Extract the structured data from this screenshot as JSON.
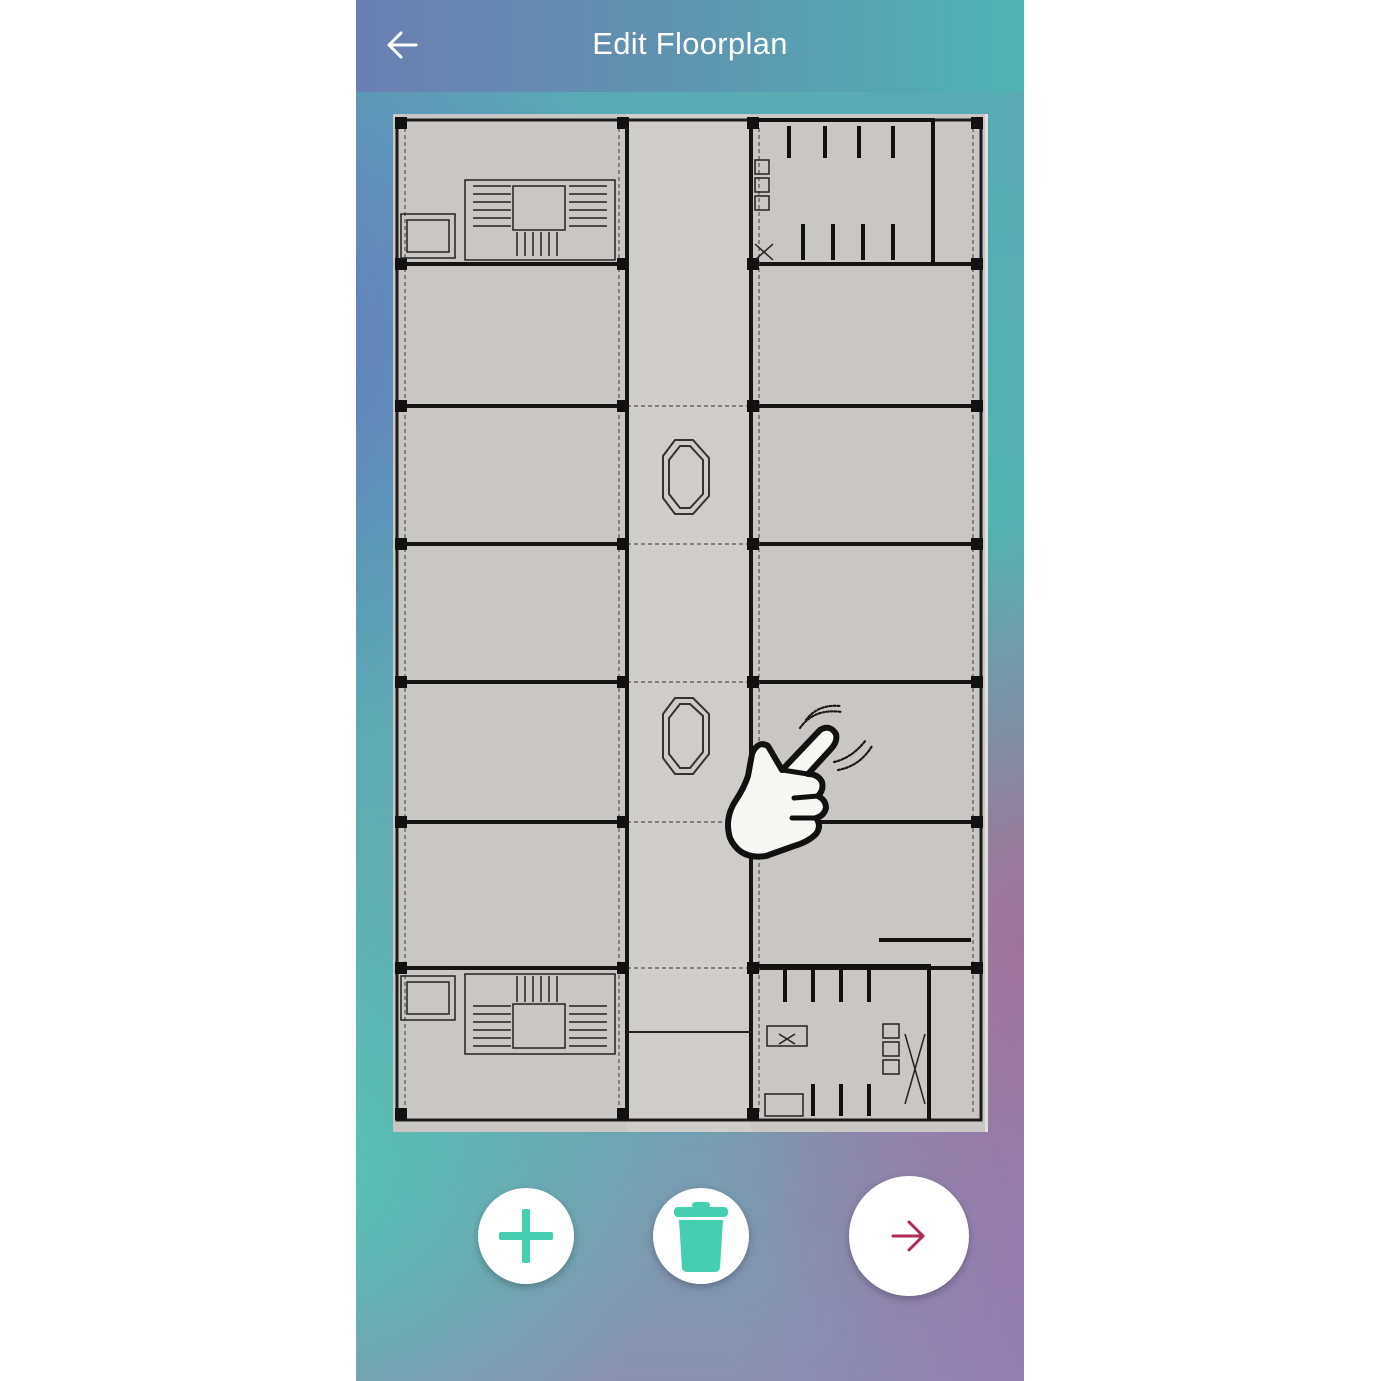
{
  "app": {
    "title": "Edit Floorplan"
  },
  "icons": {
    "back": "arrow-left-icon",
    "add": "plus-icon",
    "delete": "trash-icon",
    "next": "arrow-right-icon",
    "gesture": "tap-hand-icon"
  },
  "colors": {
    "accent": "#45cfb0",
    "next_arrow": "#b0285a",
    "appbar_text": "#ffffff",
    "plan_fill": "#c8c6c3",
    "plan_walls": "#111111"
  }
}
